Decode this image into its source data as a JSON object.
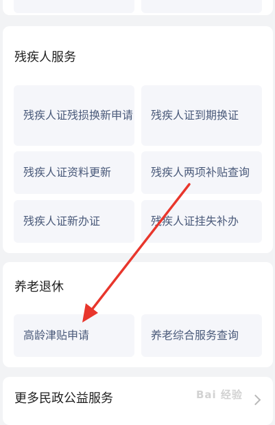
{
  "sections": {
    "disability": {
      "title": "残疾人服务",
      "items": [
        {
          "label": "残疾人证残损换新申请"
        },
        {
          "label": "残疾人证到期换证"
        },
        {
          "label": "残疾人证资料更新"
        },
        {
          "label": "残疾人两项补贴查询"
        },
        {
          "label": "残疾人证新办证"
        },
        {
          "label": "残疾人证挂失补办"
        }
      ]
    },
    "elderly": {
      "title": "养老退休",
      "items": [
        {
          "label": "高龄津贴申请"
        },
        {
          "label": "养老综合服务查询"
        }
      ]
    },
    "more": {
      "title": "更多民政公益服务"
    }
  },
  "watermark": "Bai 经验",
  "annotation": {
    "arrow_color": "#e8362c"
  }
}
